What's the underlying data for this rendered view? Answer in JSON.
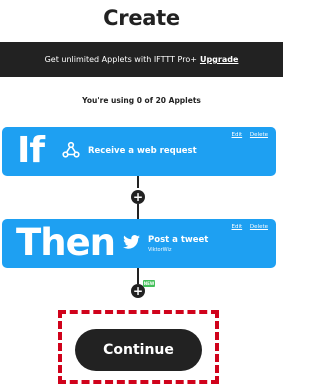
{
  "header": {
    "title": "Create"
  },
  "promo": {
    "text": "Get unlimited Applets with IFTTT Pro+",
    "link": "Upgrade"
  },
  "usage": {
    "text": "You're using 0 of 20 Applets"
  },
  "if_card": {
    "word": "If",
    "service_icon": "webhooks-icon",
    "action": "Receive a web request",
    "edit": "Edit",
    "delete": "Delete"
  },
  "then_card": {
    "word": "Then",
    "service_icon": "twitter-icon",
    "action": "Post a tweet",
    "account": "ViktorWiz",
    "edit": "Edit",
    "delete": "Delete"
  },
  "add_step": {
    "badge": "NEW"
  },
  "continue_button": {
    "label": "Continue"
  },
  "colors": {
    "card_blue": "#1ea0f2",
    "dark": "#222222",
    "highlight": "#d0021b",
    "badge_green": "#44c05a"
  }
}
